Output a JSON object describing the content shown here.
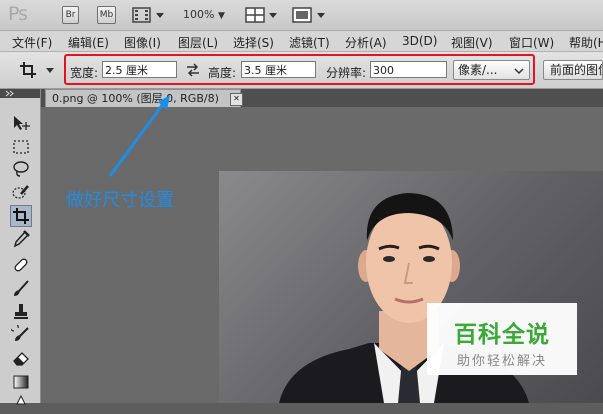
{
  "app": {
    "logo_text": "Ps",
    "bridge_btn": "Br",
    "minibridge_btn": "Mb",
    "zoom_level": "100%"
  },
  "menu": {
    "items": [
      "文件(F)",
      "编辑(E)",
      "图像(I)",
      "图层(L)",
      "选择(S)",
      "滤镜(T)",
      "分析(A)",
      "3D(D)",
      "视图(V)",
      "窗口(W)",
      "帮助(H)"
    ]
  },
  "options": {
    "width_label": "宽度:",
    "width_value": "2.5 厘米",
    "height_label": "高度:",
    "height_value": "3.5 厘米",
    "resolution_label": "分辨率:",
    "resolution_value": "300",
    "unit_select": "像素/...",
    "front_image_btn": "前面的图像"
  },
  "document": {
    "tab_label": "0.png @ 100% (图层 0, RGB/8)",
    "close_symbol": "✕"
  },
  "annotation": {
    "text": "做好尺寸设置",
    "color": "#1c8ee8"
  },
  "watermark": {
    "title": "百科全说",
    "subtitle": "助你轻松解决"
  },
  "colors": {
    "highlight_box": "#e3141e",
    "watermark_green": "#3aa935"
  }
}
